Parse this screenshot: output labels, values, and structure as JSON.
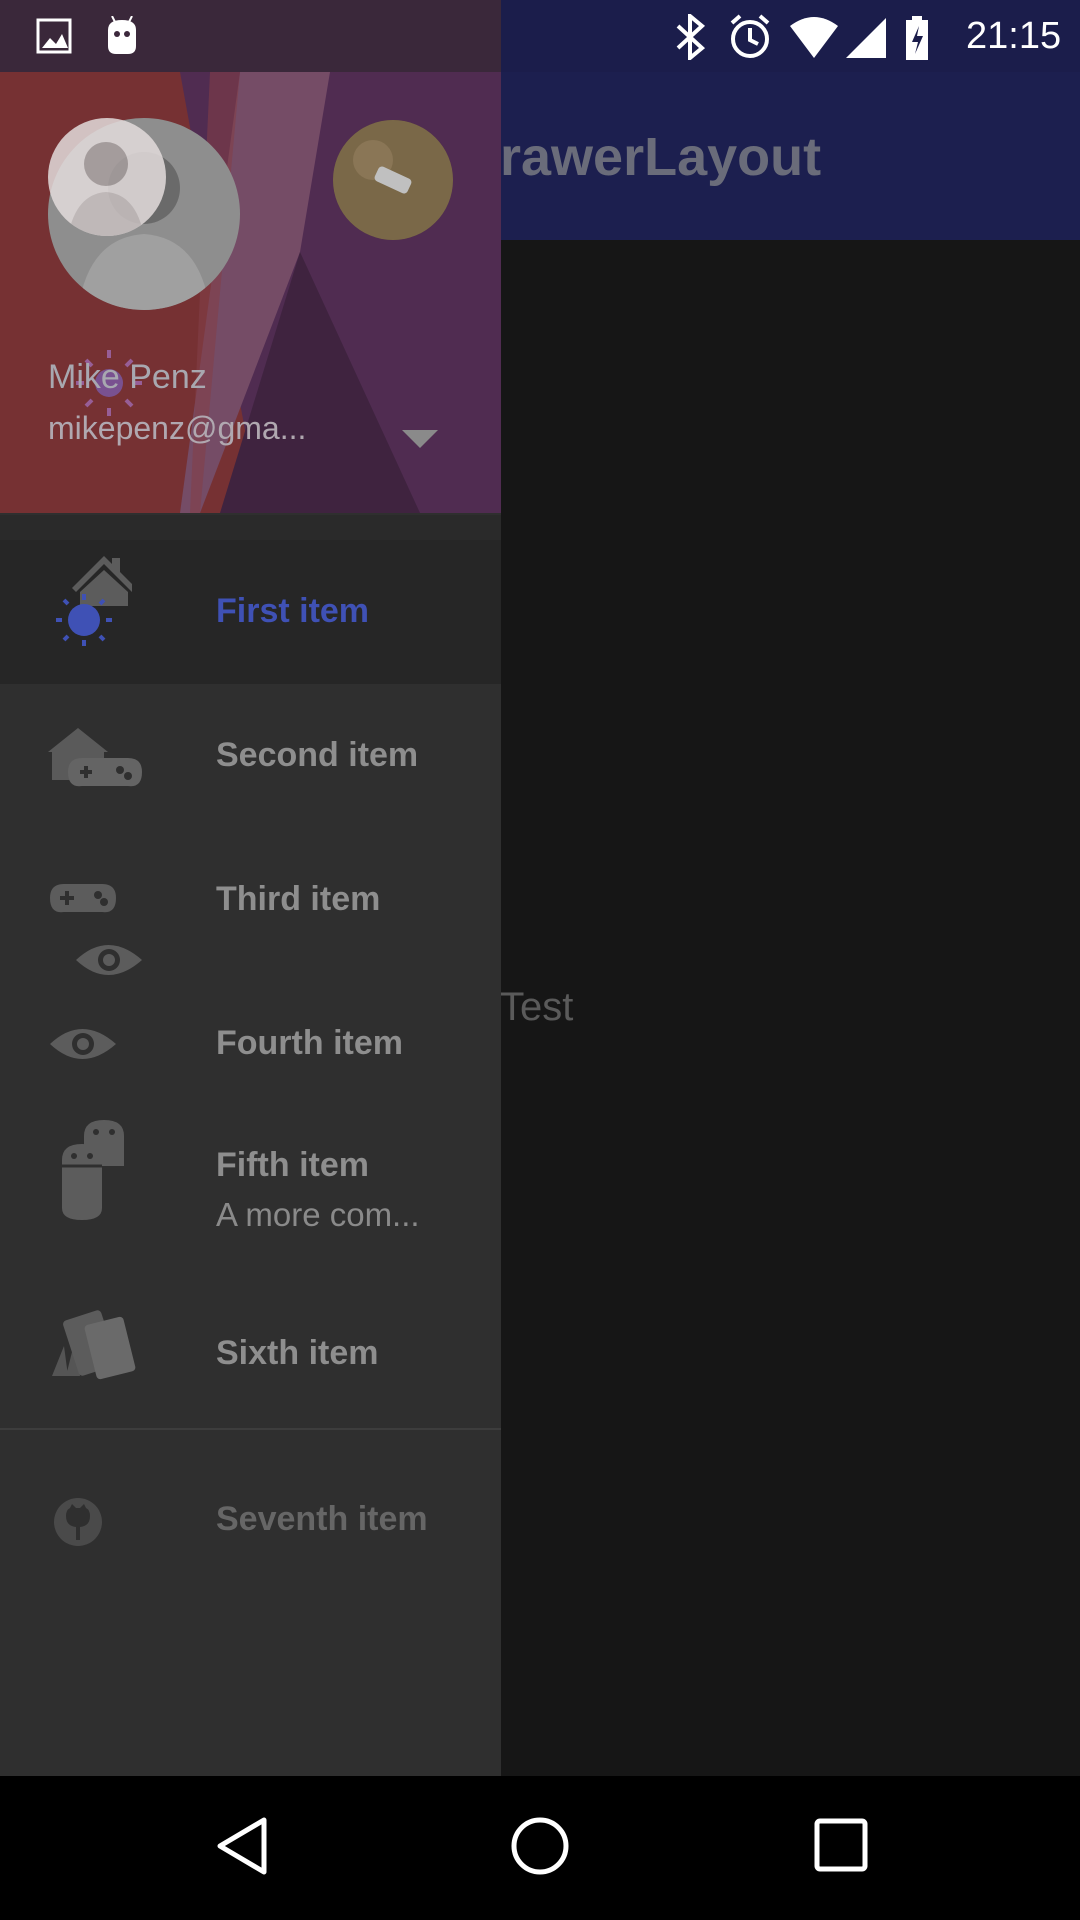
{
  "status_bar": {
    "time": "21:15",
    "icons": [
      "image-icon",
      "android-notification-icon",
      "bluetooth-icon",
      "alarm-icon",
      "wifi-icon",
      "signal-icon",
      "battery-charging-icon"
    ]
  },
  "toolbar": {
    "title": "rawerLayout"
  },
  "main": {
    "text": "Test"
  },
  "drawer": {
    "header": {
      "name": "Mike Penz",
      "email": "mikepenz@gma...",
      "dropdown_icon": "arrow-drop-down-icon"
    },
    "items": [
      {
        "label": "First item",
        "icon": "home-icon",
        "selected": true
      },
      {
        "label": "Second item",
        "icon": "gamepad-icon"
      },
      {
        "label": "Third item",
        "icon": "gamepad-icon"
      },
      {
        "label": "Fourth item",
        "icon": "eye-icon"
      },
      {
        "label": "Fifth item",
        "description": "A more com...",
        "icon": "android-icon"
      },
      {
        "label": "Sixth item",
        "icon": "cards-icon"
      }
    ],
    "secondary_items": [
      {
        "label": "Seventh item",
        "icon": "github-icon"
      }
    ]
  },
  "colors": {
    "toolbar": "#1c1f4f",
    "selected_text": "#3f51b5",
    "drawer_bg": "#2f2f2f"
  },
  "nav_bar": {
    "buttons": [
      "back-button",
      "home-button",
      "recents-button"
    ]
  }
}
